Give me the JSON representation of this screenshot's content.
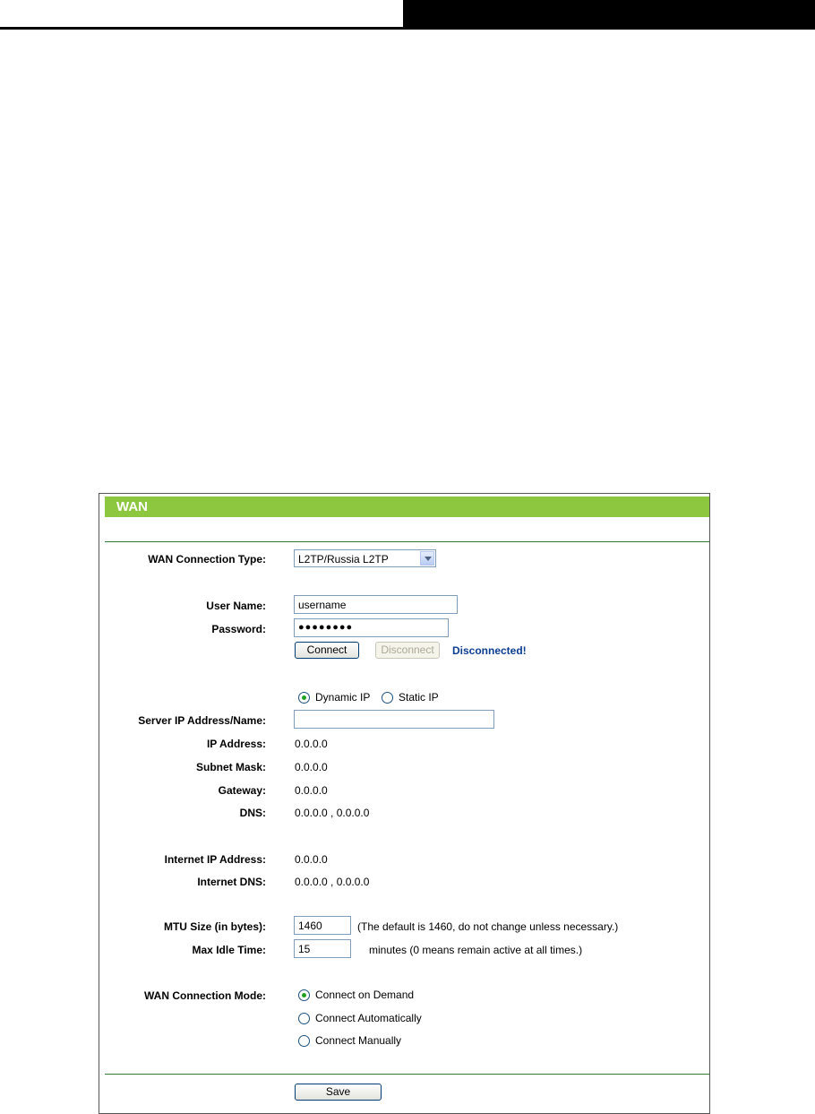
{
  "panel": {
    "title": "WAN"
  },
  "wan_type": {
    "label": "WAN Connection Type:",
    "selected": "L2TP/Russia L2TP"
  },
  "user": {
    "label": "User Name:",
    "value": "username"
  },
  "password": {
    "label": "Password:",
    "value": "●●●●●●●●"
  },
  "connect": {
    "connect_label": "Connect",
    "disconnect_label": "Disconnect",
    "status": "Disconnected!"
  },
  "ip_mode": {
    "dynamic_label": "Dynamic IP",
    "static_label": "Static IP",
    "selected": "Dynamic IP"
  },
  "server": {
    "label": "Server IP Address/Name:",
    "value": ""
  },
  "ip": {
    "label": "IP Address:",
    "value": "0.0.0.0"
  },
  "subnet": {
    "label": "Subnet Mask:",
    "value": "0.0.0.0"
  },
  "gateway": {
    "label": "Gateway:",
    "value": "0.0.0.0"
  },
  "dns": {
    "label": "DNS:",
    "value": "0.0.0.0 , 0.0.0.0"
  },
  "internet_ip": {
    "label": "Internet IP Address:",
    "value": "0.0.0.0"
  },
  "internet_dns": {
    "label": "Internet DNS:",
    "value": "0.0.0.0 , 0.0.0.0"
  },
  "mtu": {
    "label": "MTU Size (in bytes):",
    "value": "1460",
    "hint": "(The default is 1460, do not change unless necessary.)"
  },
  "idle": {
    "label": "Max Idle Time:",
    "value": "15",
    "hint": "minutes (0 means remain active at all times.)"
  },
  "mode": {
    "label": "WAN Connection Mode:",
    "options": [
      "Connect on Demand",
      "Connect Automatically",
      "Connect Manually"
    ],
    "selected": "Connect on Demand"
  },
  "save": {
    "label": "Save"
  },
  "colors": {
    "title_bar": "#8dc63f",
    "status_text": "#0b3d91",
    "rule": "#2f7a31"
  }
}
